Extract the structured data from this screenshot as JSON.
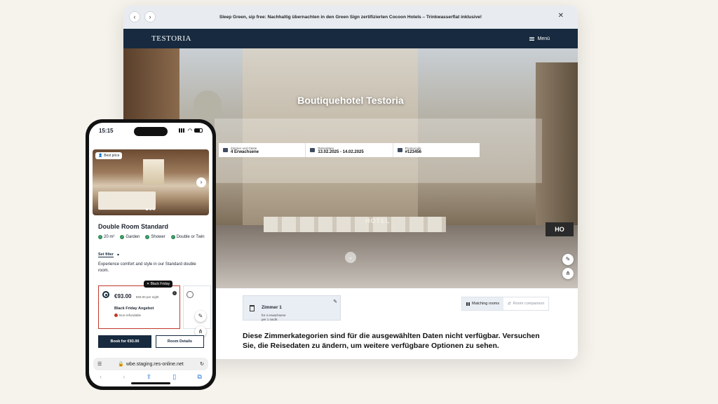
{
  "browser": {
    "back_icon": "chevron-left-icon",
    "forward_icon": "chevron-right-icon",
    "promo_text": "Sleep Green, sip free: Nachhaltig übernachten in den Green Sign zertifizierten Cocoon Hotels – Trinkwasserflat inklusive!",
    "close_icon": "close-icon"
  },
  "header": {
    "logo": "TESTORIA",
    "menu_label": "Menü"
  },
  "hero": {
    "title": "Boutiquehotel Testoria",
    "hotel_sign": "HOTEL",
    "ho_sign": "HO"
  },
  "search": {
    "guests": {
      "label": "Zimmer und Gäste",
      "value": "4 Erwachsene"
    },
    "dates": {
      "label": "Reisedaten",
      "value": "13.02.2025 - 14.02.2025"
    },
    "promo": {
      "label": "Promocode",
      "value": "#123456"
    }
  },
  "room_summary": {
    "title": "Zimmer 1",
    "guests": "für 4 erwachsene",
    "nights": "per 1 nacht"
  },
  "view_toggle": {
    "matching": "Matching rooms",
    "comparison": "Room comparison"
  },
  "unavailable_message": "Diese Zimmerkategorien sind für die ausgewählten Daten nicht verfügbar. Versuchen Sie, die Reisedaten zu ändern, um weitere verfügbare Optionen zu sehen.",
  "phone": {
    "time": "15:15",
    "badge": "Best price",
    "room_title": "Double Room Standard",
    "amenities": [
      "20 m²",
      "Garden",
      "Shower",
      "Double or Twin"
    ],
    "filter_label": "Set filter",
    "description": "Experience comfort and style in our Standard double room.",
    "rate": {
      "tag": "Black Friday",
      "price": "€93.00",
      "per_night": "€93.00 per night",
      "name": "Black Friday Angebot",
      "policy": "Non-refundable"
    },
    "book_button": "Book for €93.00",
    "details_button": "Room Details",
    "url": "wbe.staging.res-online.net"
  },
  "colors": {
    "brand_navy": "#172a3f",
    "accent_red": "#c0392b",
    "amenity_green": "#2e8b57"
  }
}
